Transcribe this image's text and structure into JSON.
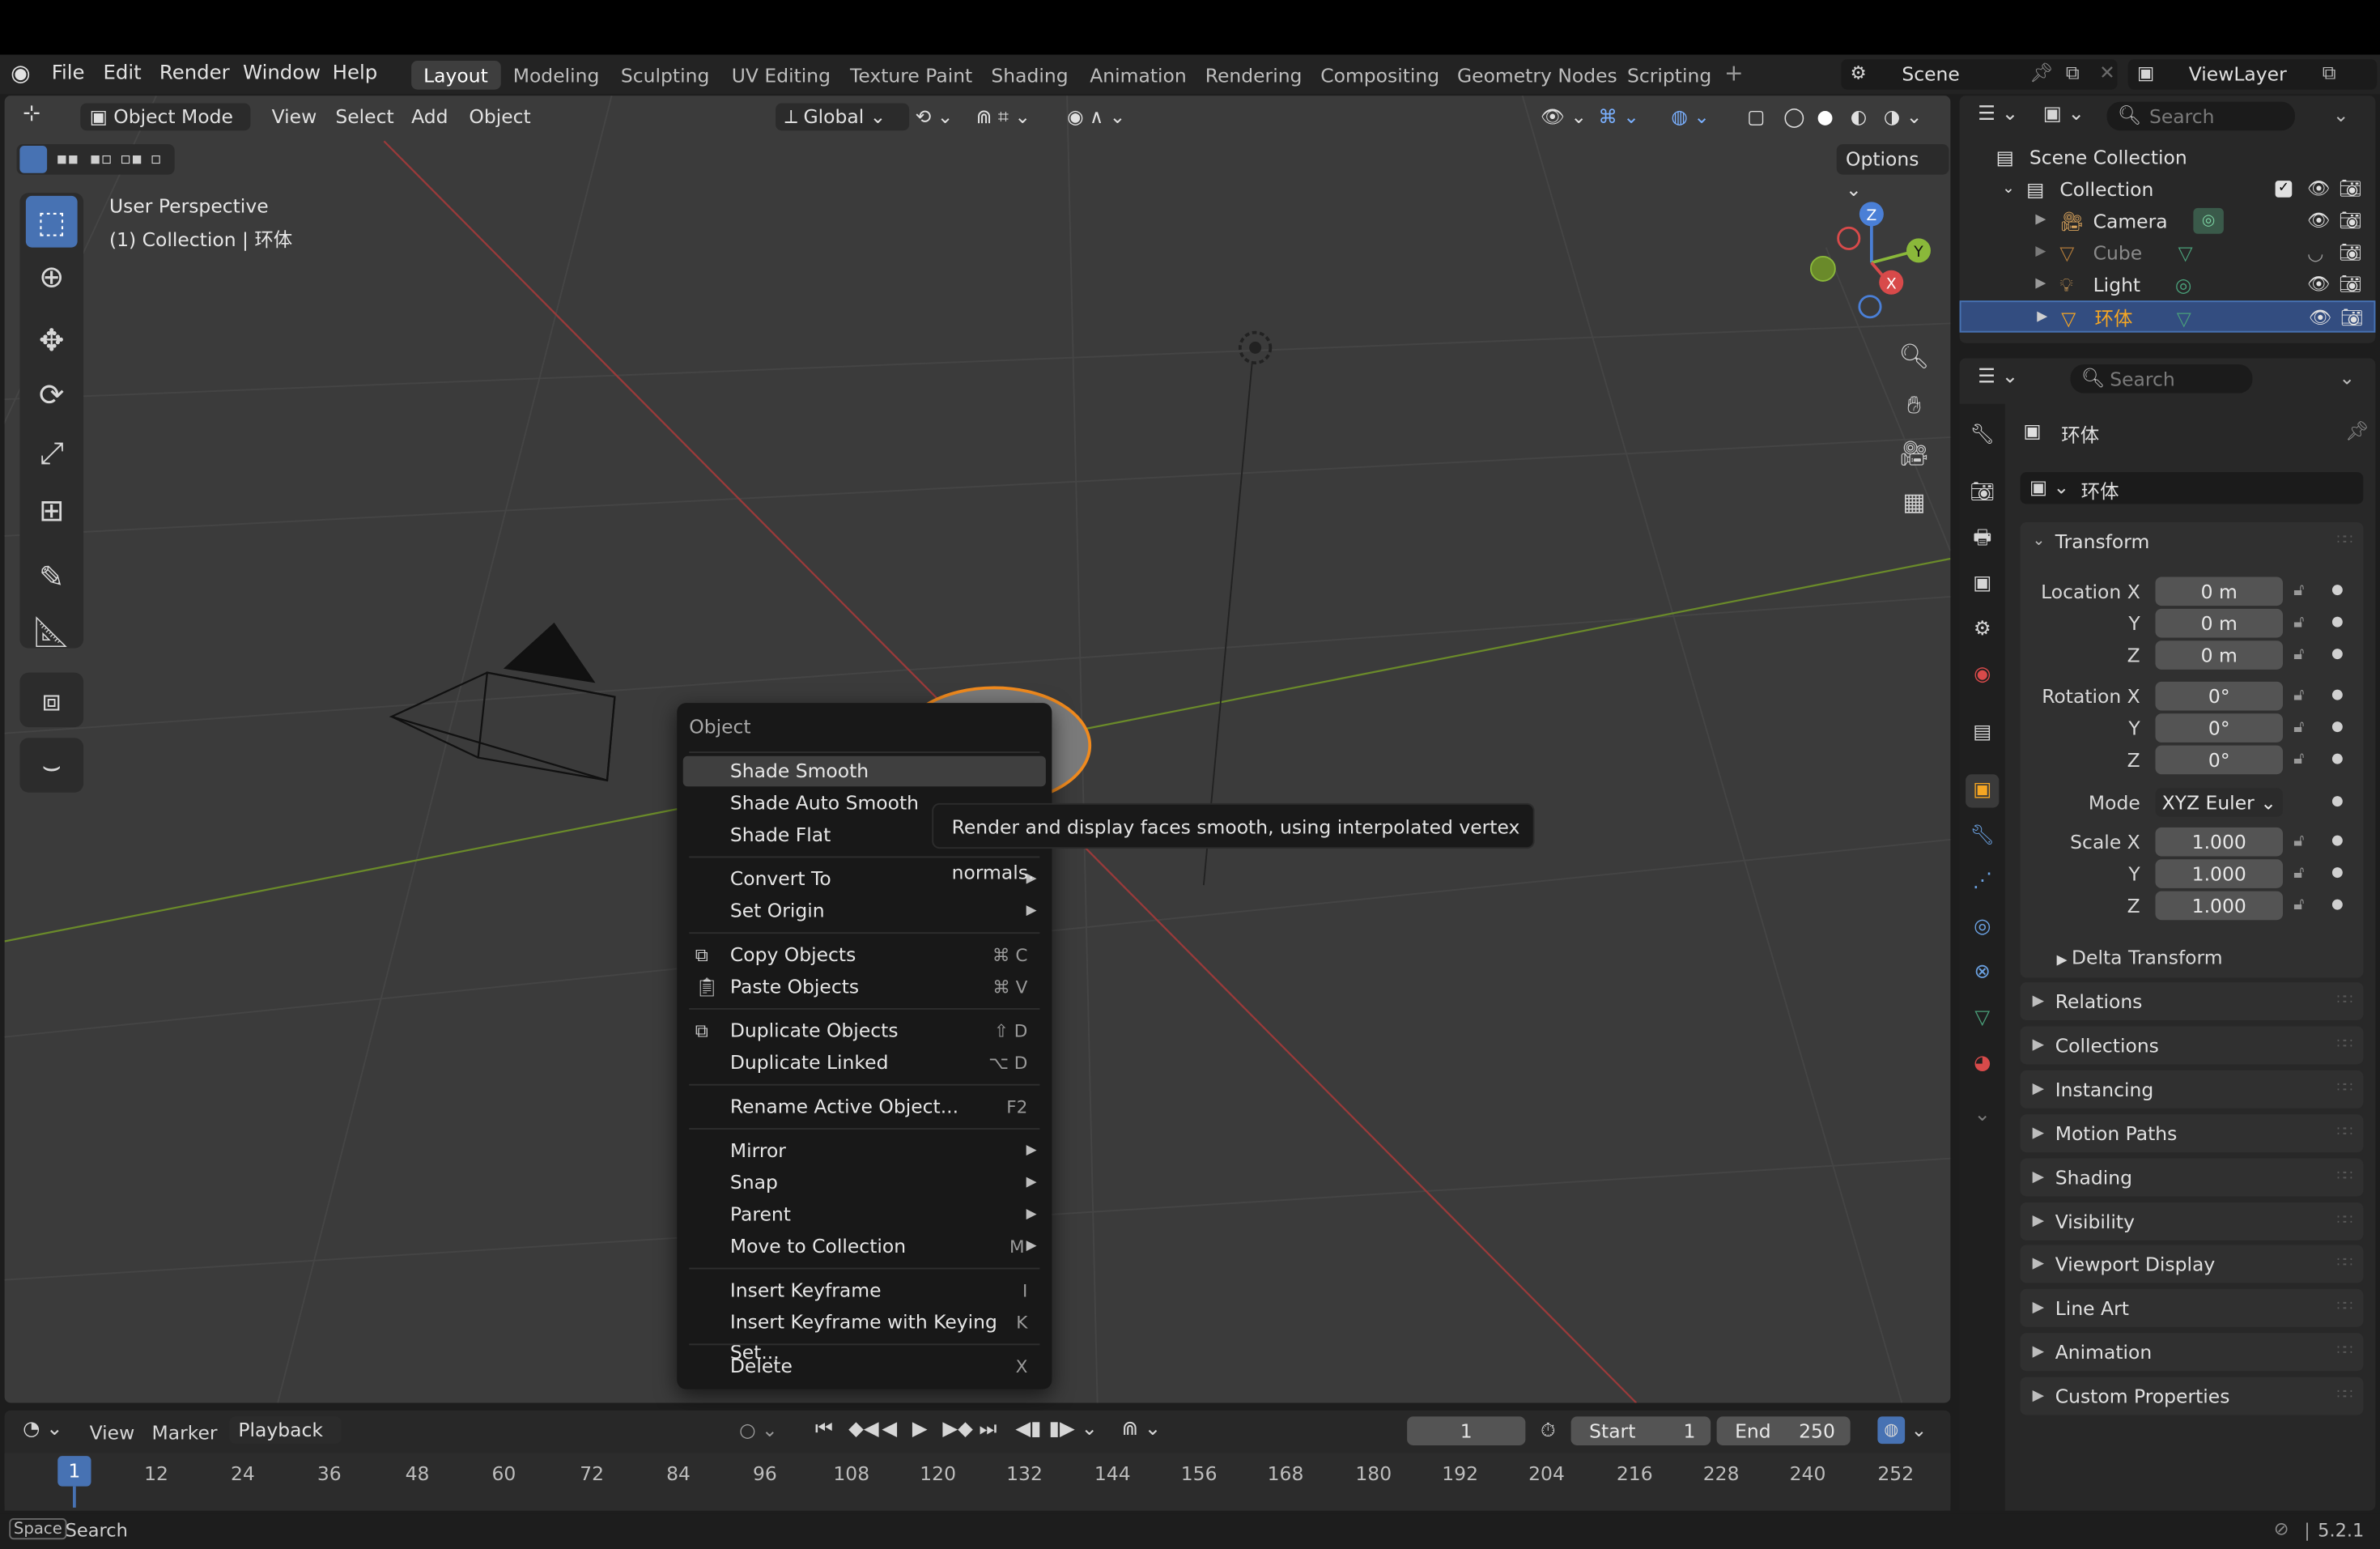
{
  "app": {
    "menus": [
      "File",
      "Edit",
      "Render",
      "Window",
      "Help"
    ],
    "workspaces": [
      "Layout",
      "Modeling",
      "Sculpting",
      "UV Editing",
      "Texture Paint",
      "Shading",
      "Animation",
      "Rendering",
      "Compositing",
      "Geometry Nodes",
      "Scripting"
    ],
    "active_workspace": "Layout",
    "scene": "Scene",
    "view_layer": "ViewLayer"
  },
  "viewport": {
    "mode": "Object Mode",
    "header_menus": [
      "View",
      "Select",
      "Add",
      "Object"
    ],
    "orientation": "Global",
    "options": "Options",
    "overlay_line1": "User Perspective",
    "overlay_line2": "(1) Collection | 环体",
    "gizmo": {
      "z": "Z",
      "y": "Y",
      "x": "X"
    }
  },
  "context_menu": {
    "title": "Object",
    "items": [
      {
        "label": "Shade Smooth",
        "shortcut": "",
        "submenu": false,
        "icon": ""
      },
      {
        "label": "Shade Auto Smooth",
        "shortcut": "",
        "submenu": false,
        "icon": ""
      },
      {
        "label": "Shade Flat",
        "shortcut": "",
        "submenu": false,
        "icon": ""
      },
      {
        "label": "Convert To",
        "shortcut": "",
        "submenu": true,
        "icon": ""
      },
      {
        "label": "Set Origin",
        "shortcut": "",
        "submenu": true,
        "icon": ""
      },
      {
        "label": "Copy Objects",
        "shortcut": "⌘ C",
        "submenu": false,
        "icon": "copy-icon"
      },
      {
        "label": "Paste Objects",
        "shortcut": "⌘ V",
        "submenu": false,
        "icon": "paste-icon"
      },
      {
        "label": "Duplicate Objects",
        "shortcut": "⇧ D",
        "submenu": false,
        "icon": "duplicate-icon"
      },
      {
        "label": "Duplicate Linked",
        "shortcut": "⌥ D",
        "submenu": false,
        "icon": ""
      },
      {
        "label": "Rename Active Object...",
        "shortcut": "F2",
        "submenu": false,
        "icon": ""
      },
      {
        "label": "Mirror",
        "shortcut": "",
        "submenu": true,
        "icon": ""
      },
      {
        "label": "Snap",
        "shortcut": "",
        "submenu": true,
        "icon": ""
      },
      {
        "label": "Parent",
        "shortcut": "",
        "submenu": true,
        "icon": ""
      },
      {
        "label": "Move to Collection",
        "shortcut": "M",
        "submenu": true,
        "icon": ""
      },
      {
        "label": "Insert Keyframe",
        "shortcut": "I",
        "submenu": false,
        "icon": ""
      },
      {
        "label": "Insert Keyframe with Keying Set...",
        "shortcut": "K",
        "submenu": false,
        "icon": ""
      },
      {
        "label": "Delete",
        "shortcut": "X",
        "submenu": false,
        "icon": ""
      }
    ],
    "tooltip": "Render and display faces smooth, using interpolated vertex normals."
  },
  "outliner": {
    "search_placeholder": "Search",
    "scene_collection": "Scene Collection",
    "collection": "Collection",
    "objects": [
      {
        "name": "Camera",
        "icon": "camera-icon",
        "dimmed": false,
        "selected": false
      },
      {
        "name": "Cube",
        "icon": "mesh-icon",
        "dimmed": true,
        "selected": false
      },
      {
        "name": "Light",
        "icon": "light-icon",
        "dimmed": false,
        "selected": false
      },
      {
        "name": "环体",
        "icon": "mesh-icon",
        "dimmed": false,
        "selected": true
      }
    ]
  },
  "properties": {
    "search_placeholder": "Search",
    "object_name": "环体",
    "object_field": "环体",
    "transform": {
      "title": "Transform",
      "location_label": "Location X",
      "rotation_label": "Rotation X",
      "scale_label": "Scale X",
      "y": "Y",
      "z": "Z",
      "location": [
        "0 m",
        "0 m",
        "0 m"
      ],
      "rotation": [
        "0°",
        "0°",
        "0°"
      ],
      "mode_label": "Mode",
      "mode": "XYZ Euler",
      "scale": [
        "1.000",
        "1.000",
        "1.000"
      ],
      "delta": "Delta Transform"
    },
    "panels": [
      "Relations",
      "Collections",
      "Instancing",
      "Motion Paths",
      "Shading",
      "Visibility",
      "Viewport Display",
      "Line Art",
      "Animation",
      "Custom Properties"
    ]
  },
  "timeline": {
    "menus": [
      "View",
      "Marker"
    ],
    "playback": "Playback",
    "current_frame": "1",
    "start_label": "Start",
    "start": "1",
    "end_label": "End",
    "end": "250",
    "ticks": [
      "1",
      "12",
      "24",
      "36",
      "48",
      "60",
      "72",
      "84",
      "96",
      "108",
      "120",
      "132",
      "144",
      "156",
      "168",
      "180",
      "192",
      "204",
      "216",
      "228",
      "240",
      "252"
    ]
  },
  "status": {
    "key": "Space",
    "action": "Search",
    "version": "5.2.1"
  }
}
